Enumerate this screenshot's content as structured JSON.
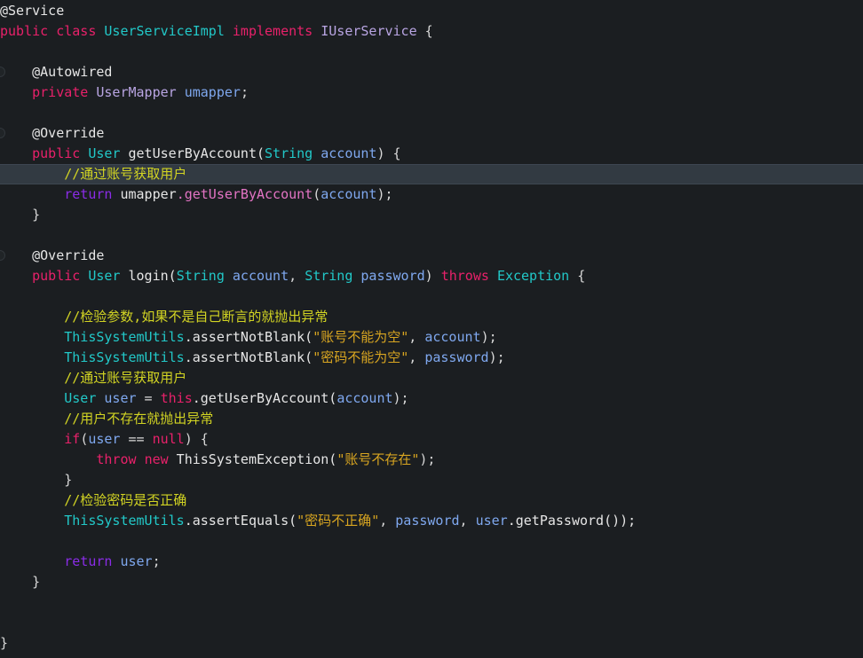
{
  "editor": {
    "language": "java",
    "background_color": "#1b1e21",
    "current_line_background": "#323a42",
    "current_line_number": 10,
    "font_size_px": 15,
    "line_height_px": 23,
    "colors": {
      "plain": "#e6e6e6",
      "keyword": "#e8216a",
      "type": "#22c8c8",
      "interface": "#b9a5e3",
      "variable": "#7fa8ef",
      "comment": "#d2d423",
      "string": "#d8a521",
      "method_call": "#e374c4",
      "return_keyword": "#8b2ce8"
    }
  },
  "gutter": {
    "marker_icon_name": "implements-method-marker-icon",
    "marker_lines": [
      4,
      7,
      14
    ]
  },
  "lines": [
    {
      "n": 1,
      "marker": false,
      "highlight": false,
      "tokens": [
        {
          "t": "@Service",
          "c": "t-anno"
        }
      ]
    },
    {
      "n": 2,
      "marker": false,
      "highlight": false,
      "tokens": [
        {
          "t": "public",
          "c": "t-kw"
        },
        {
          "t": " ",
          "c": "t-plain"
        },
        {
          "t": "class",
          "c": "t-kw"
        },
        {
          "t": " ",
          "c": "t-plain"
        },
        {
          "t": "UserServiceImpl",
          "c": "t-type"
        },
        {
          "t": " ",
          "c": "t-plain"
        },
        {
          "t": "implements",
          "c": "t-kw"
        },
        {
          "t": " ",
          "c": "t-plain"
        },
        {
          "t": "IUserService",
          "c": "t-iface"
        },
        {
          "t": " {",
          "c": "t-punct"
        }
      ]
    },
    {
      "n": 3,
      "marker": false,
      "highlight": false,
      "tokens": []
    },
    {
      "n": 4,
      "marker": true,
      "highlight": false,
      "tokens": [
        {
          "t": "    @Autowired",
          "c": "t-anno"
        }
      ]
    },
    {
      "n": 5,
      "marker": false,
      "highlight": false,
      "tokens": [
        {
          "t": "    ",
          "c": "t-plain"
        },
        {
          "t": "private",
          "c": "t-kw"
        },
        {
          "t": " ",
          "c": "t-plain"
        },
        {
          "t": "UserMapper",
          "c": "t-iface"
        },
        {
          "t": " ",
          "c": "t-plain"
        },
        {
          "t": "umapper",
          "c": "t-var"
        },
        {
          "t": ";",
          "c": "t-punct"
        }
      ]
    },
    {
      "n": 6,
      "marker": false,
      "highlight": false,
      "tokens": []
    },
    {
      "n": 7,
      "marker": true,
      "highlight": false,
      "tokens": [
        {
          "t": "    @Override",
          "c": "t-anno"
        }
      ]
    },
    {
      "n": 8,
      "marker": false,
      "highlight": false,
      "tokens": [
        {
          "t": "    ",
          "c": "t-plain"
        },
        {
          "t": "public",
          "c": "t-kw"
        },
        {
          "t": " ",
          "c": "t-plain"
        },
        {
          "t": "User",
          "c": "t-type"
        },
        {
          "t": " getUserByAccount(",
          "c": "t-plain"
        },
        {
          "t": "String",
          "c": "t-type"
        },
        {
          "t": " ",
          "c": "t-plain"
        },
        {
          "t": "account",
          "c": "t-var"
        },
        {
          "t": ") {",
          "c": "t-punct"
        }
      ]
    },
    {
      "n": 9,
      "marker": false,
      "highlight": true,
      "tokens": [
        {
          "t": "        //通过账号获取用户",
          "c": "t-comment"
        }
      ]
    },
    {
      "n": 10,
      "marker": false,
      "highlight": false,
      "tokens": [
        {
          "t": "        ",
          "c": "t-plain"
        },
        {
          "t": "return",
          "c": "t-return"
        },
        {
          "t": " umapper",
          "c": "t-plain"
        },
        {
          "t": ".getUserByAccount",
          "c": "t-call"
        },
        {
          "t": "(",
          "c": "t-punct"
        },
        {
          "t": "account",
          "c": "t-var"
        },
        {
          "t": ");",
          "c": "t-punct"
        }
      ]
    },
    {
      "n": 11,
      "marker": false,
      "highlight": false,
      "tokens": [
        {
          "t": "    }",
          "c": "t-punct"
        }
      ]
    },
    {
      "n": 12,
      "marker": false,
      "highlight": false,
      "tokens": []
    },
    {
      "n": 13,
      "marker": true,
      "highlight": false,
      "tokens": [
        {
          "t": "    @Override",
          "c": "t-anno"
        }
      ]
    },
    {
      "n": 14,
      "marker": false,
      "highlight": false,
      "tokens": [
        {
          "t": "    ",
          "c": "t-plain"
        },
        {
          "t": "public",
          "c": "t-kw"
        },
        {
          "t": " ",
          "c": "t-plain"
        },
        {
          "t": "User",
          "c": "t-type"
        },
        {
          "t": " login(",
          "c": "t-plain"
        },
        {
          "t": "String",
          "c": "t-type"
        },
        {
          "t": " ",
          "c": "t-plain"
        },
        {
          "t": "account",
          "c": "t-var"
        },
        {
          "t": ", ",
          "c": "t-punct"
        },
        {
          "t": "String",
          "c": "t-type"
        },
        {
          "t": " ",
          "c": "t-plain"
        },
        {
          "t": "password",
          "c": "t-var"
        },
        {
          "t": ") ",
          "c": "t-punct"
        },
        {
          "t": "throws",
          "c": "t-kw"
        },
        {
          "t": " ",
          "c": "t-plain"
        },
        {
          "t": "Exception",
          "c": "t-type"
        },
        {
          "t": " {",
          "c": "t-punct"
        }
      ]
    },
    {
      "n": 15,
      "marker": false,
      "highlight": false,
      "tokens": []
    },
    {
      "n": 16,
      "marker": false,
      "highlight": false,
      "tokens": [
        {
          "t": "        //检验参数,如果不是自己断言的就抛出异常",
          "c": "t-comment"
        }
      ]
    },
    {
      "n": 17,
      "marker": false,
      "highlight": false,
      "tokens": [
        {
          "t": "        ",
          "c": "t-plain"
        },
        {
          "t": "ThisSystemUtils",
          "c": "t-type"
        },
        {
          "t": ".assertNotBlank(",
          "c": "t-plain"
        },
        {
          "t": "\"账号不能为空\"",
          "c": "t-string"
        },
        {
          "t": ", ",
          "c": "t-punct"
        },
        {
          "t": "account",
          "c": "t-var"
        },
        {
          "t": ");",
          "c": "t-punct"
        }
      ]
    },
    {
      "n": 18,
      "marker": false,
      "highlight": false,
      "tokens": [
        {
          "t": "        ",
          "c": "t-plain"
        },
        {
          "t": "ThisSystemUtils",
          "c": "t-type"
        },
        {
          "t": ".assertNotBlank(",
          "c": "t-plain"
        },
        {
          "t": "\"密码不能为空\"",
          "c": "t-string"
        },
        {
          "t": ", ",
          "c": "t-punct"
        },
        {
          "t": "password",
          "c": "t-var"
        },
        {
          "t": ");",
          "c": "t-punct"
        }
      ]
    },
    {
      "n": 19,
      "marker": false,
      "highlight": false,
      "tokens": [
        {
          "t": "        //通过账号获取用户",
          "c": "t-comment"
        }
      ]
    },
    {
      "n": 20,
      "marker": false,
      "highlight": false,
      "tokens": [
        {
          "t": "        ",
          "c": "t-plain"
        },
        {
          "t": "User",
          "c": "t-type"
        },
        {
          "t": " ",
          "c": "t-plain"
        },
        {
          "t": "user",
          "c": "t-var"
        },
        {
          "t": " = ",
          "c": "t-punct"
        },
        {
          "t": "this",
          "c": "t-this"
        },
        {
          "t": ".getUserByAccount(",
          "c": "t-plain"
        },
        {
          "t": "account",
          "c": "t-var"
        },
        {
          "t": ");",
          "c": "t-punct"
        }
      ]
    },
    {
      "n": 21,
      "marker": false,
      "highlight": false,
      "tokens": [
        {
          "t": "        //用户不存在就抛出异常",
          "c": "t-comment"
        }
      ]
    },
    {
      "n": 22,
      "marker": false,
      "highlight": false,
      "tokens": [
        {
          "t": "        ",
          "c": "t-plain"
        },
        {
          "t": "if",
          "c": "t-kw"
        },
        {
          "t": "(",
          "c": "t-punct"
        },
        {
          "t": "user",
          "c": "t-var"
        },
        {
          "t": " == ",
          "c": "t-punct"
        },
        {
          "t": "null",
          "c": "t-null"
        },
        {
          "t": ") {",
          "c": "t-punct"
        }
      ]
    },
    {
      "n": 23,
      "marker": false,
      "highlight": false,
      "tokens": [
        {
          "t": "            ",
          "c": "t-plain"
        },
        {
          "t": "throw",
          "c": "t-kw"
        },
        {
          "t": " ",
          "c": "t-plain"
        },
        {
          "t": "new",
          "c": "t-kw"
        },
        {
          "t": " ThisSystemException(",
          "c": "t-plain"
        },
        {
          "t": "\"账号不存在\"",
          "c": "t-string"
        },
        {
          "t": ");",
          "c": "t-punct"
        }
      ]
    },
    {
      "n": 24,
      "marker": false,
      "highlight": false,
      "tokens": [
        {
          "t": "        }",
          "c": "t-punct"
        }
      ]
    },
    {
      "n": 25,
      "marker": false,
      "highlight": false,
      "tokens": [
        {
          "t": "        //检验密码是否正确",
          "c": "t-comment"
        }
      ]
    },
    {
      "n": 26,
      "marker": false,
      "highlight": false,
      "tokens": [
        {
          "t": "        ",
          "c": "t-plain"
        },
        {
          "t": "ThisSystemUtils",
          "c": "t-type"
        },
        {
          "t": ".assertEquals(",
          "c": "t-plain"
        },
        {
          "t": "\"密码不正确\"",
          "c": "t-string"
        },
        {
          "t": ", ",
          "c": "t-punct"
        },
        {
          "t": "password",
          "c": "t-var"
        },
        {
          "t": ", ",
          "c": "t-punct"
        },
        {
          "t": "user",
          "c": "t-var"
        },
        {
          "t": ".getPassword());",
          "c": "t-plain"
        }
      ]
    },
    {
      "n": 27,
      "marker": false,
      "highlight": false,
      "tokens": []
    },
    {
      "n": 28,
      "marker": false,
      "highlight": false,
      "tokens": [
        {
          "t": "        ",
          "c": "t-plain"
        },
        {
          "t": "return",
          "c": "t-return"
        },
        {
          "t": " ",
          "c": "t-plain"
        },
        {
          "t": "user",
          "c": "t-var"
        },
        {
          "t": ";",
          "c": "t-punct"
        }
      ]
    },
    {
      "n": 29,
      "marker": false,
      "highlight": false,
      "tokens": [
        {
          "t": "    }",
          "c": "t-punct"
        }
      ]
    },
    {
      "n": 30,
      "marker": false,
      "highlight": false,
      "tokens": []
    },
    {
      "n": 31,
      "marker": false,
      "highlight": false,
      "tokens": []
    },
    {
      "n": 32,
      "marker": false,
      "highlight": false,
      "tokens": [
        {
          "t": "}",
          "c": "t-punct"
        }
      ]
    }
  ]
}
